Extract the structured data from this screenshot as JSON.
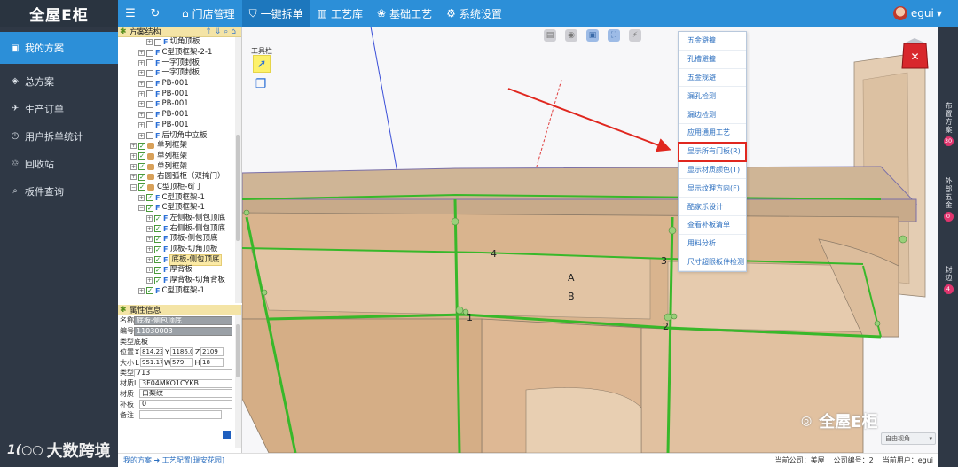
{
  "app": {
    "logo": "全屋E柜",
    "top_menu": [
      {
        "label": "门店管理",
        "icon": "store-icon"
      },
      {
        "label": "一键拆单",
        "icon": "shield-icon",
        "active": true
      },
      {
        "label": "工艺库",
        "icon": "chart-icon"
      },
      {
        "label": "基础工艺",
        "icon": "palette-icon"
      },
      {
        "label": "系统设置",
        "icon": "gear-icon"
      }
    ],
    "user": "egui"
  },
  "sidebar": {
    "items": [
      {
        "label": "我的方案",
        "active": true
      },
      {
        "label": "总方案"
      },
      {
        "label": "生产订单"
      },
      {
        "label": "用户拆单统计"
      },
      {
        "label": "回收站"
      },
      {
        "label": "板件查询"
      }
    ],
    "watermark": "大数跨境"
  },
  "tree": {
    "title": "方案结构",
    "rows": [
      {
        "indent": 2,
        "label": "切角顶板",
        "checked": false,
        "icon": "f"
      },
      {
        "indent": 1,
        "label": "C型顶框架-2-1",
        "checked": false,
        "icon": "f"
      },
      {
        "indent": 1,
        "label": "一字顶封板",
        "checked": false,
        "icon": "f"
      },
      {
        "indent": 1,
        "label": "一字顶封板",
        "checked": false,
        "icon": "f"
      },
      {
        "indent": 1,
        "label": "PB-001",
        "checked": false,
        "icon": "f"
      },
      {
        "indent": 1,
        "label": "PB-001",
        "checked": false,
        "icon": "f"
      },
      {
        "indent": 1,
        "label": "PB-001",
        "checked": false,
        "icon": "f"
      },
      {
        "indent": 1,
        "label": "PB-001",
        "checked": false,
        "icon": "f"
      },
      {
        "indent": 1,
        "label": "PB-001",
        "checked": false,
        "icon": "f"
      },
      {
        "indent": 1,
        "label": "后切角中立板",
        "checked": false,
        "icon": "f"
      },
      {
        "indent": 0,
        "label": "单列框架",
        "checked": true,
        "icon": "b"
      },
      {
        "indent": 0,
        "label": "单列框架",
        "checked": true,
        "icon": "b"
      },
      {
        "indent": 0,
        "label": "单列框架",
        "checked": true,
        "icon": "b"
      },
      {
        "indent": 0,
        "label": "右圆弧柜（双掩门）",
        "checked": true,
        "icon": "b"
      },
      {
        "indent": 0,
        "label": "C型顶柜-6门",
        "checked": true,
        "icon": "b",
        "expanded": true
      },
      {
        "indent": 1,
        "label": "C型顶框架-1",
        "checked": true,
        "icon": "f"
      },
      {
        "indent": 1,
        "label": "C型顶框架-1",
        "checked": true,
        "icon": "f",
        "expanded": true
      },
      {
        "indent": 2,
        "label": "左侧板-侧包顶底",
        "checked": true,
        "icon": "f"
      },
      {
        "indent": 2,
        "label": "右侧板-侧包顶底",
        "checked": true,
        "icon": "f"
      },
      {
        "indent": 2,
        "label": "顶板-侧包顶底",
        "checked": true,
        "icon": "f"
      },
      {
        "indent": 2,
        "label": "顶板-切角顶板",
        "checked": true,
        "icon": "f"
      },
      {
        "indent": 2,
        "label": "底板-侧包顶底",
        "checked": true,
        "icon": "f",
        "selected": true
      },
      {
        "indent": 2,
        "label": "厚背板",
        "checked": true,
        "icon": "f"
      },
      {
        "indent": 2,
        "label": "厚背板-切角背板",
        "checked": true,
        "icon": "f"
      },
      {
        "indent": 1,
        "label": "C型顶框架-1",
        "checked": true,
        "icon": "f"
      }
    ]
  },
  "attributes": {
    "title": "属性信息",
    "name_label": "名称",
    "name": "底板-侧包顶底",
    "code_label": "编号",
    "code": "11030003",
    "type_label": "类型",
    "type": "底板",
    "pos_label": "位置",
    "x": "814.22",
    "y": "1186.0",
    "z": "2109",
    "size_label": "大小",
    "l": "951.17",
    "w": "579",
    "h": "18",
    "kind_label": "类型",
    "kind": "713",
    "material_label": "材质Il",
    "material": "3F04MKO1CYKB",
    "texture_label": "材质",
    "texture": "白梨纹",
    "patch_label": "补板",
    "patch": "0",
    "note_label": "备注",
    "note": ""
  },
  "viewport": {
    "toolbar_label": "工具栏",
    "view_select": "自由视角",
    "labels": {
      "a": "A",
      "b": "B",
      "n1": "1",
      "n2": "2",
      "n3": "3",
      "n4": "4"
    },
    "watermark": "全屋E柜"
  },
  "context_menu": {
    "items": [
      {
        "label": "五金避撞"
      },
      {
        "label": "孔槽避撞"
      },
      {
        "label": "五金规避"
      },
      {
        "label": "漏孔检测"
      },
      {
        "label": "漏边检测"
      },
      {
        "label": "应用通用工艺"
      },
      {
        "label": "显示所有门板(R)",
        "highlight": true
      },
      {
        "label": "显示材质颜色(T)"
      },
      {
        "label": "显示纹理方向(F)"
      },
      {
        "label": "酷家乐设计"
      },
      {
        "label": "查看补板清单"
      },
      {
        "label": "用料分析"
      },
      {
        "label": "尺寸超限板件检测"
      }
    ]
  },
  "right_dock": [
    {
      "label": "布置方案",
      "count": "30"
    },
    {
      "label": "外部五金",
      "count": "0"
    },
    {
      "label": "封边",
      "count": "4"
    }
  ],
  "footer": {
    "breadcrumb_1": "我的方案",
    "breadcrumb_2": "工艺配置[瑞安花园]",
    "company_label": "当前公司：美屋",
    "company_no": "公司编号：2",
    "current_user": "当前用户：egui"
  },
  "colors": {
    "accent": "#2c8fd8",
    "sidebar": "#2f3845",
    "highlight_border": "#e0271f",
    "menu_text": "#2c6fbf",
    "cabinet_fill": "#d9b48e",
    "edge_green": "#38b82a"
  }
}
